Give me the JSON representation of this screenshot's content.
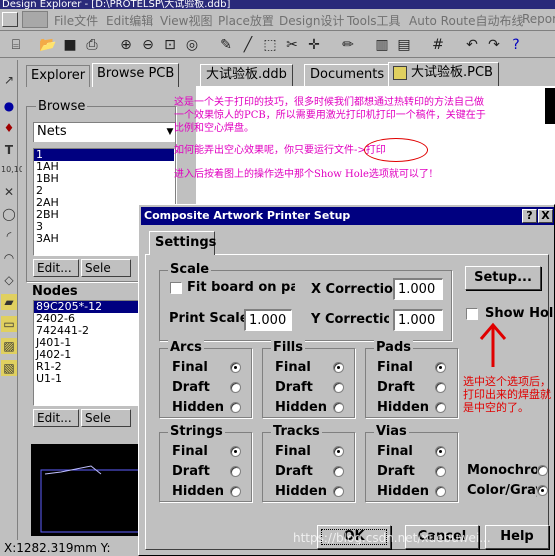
{
  "app": {
    "title": "Design Explorer - [D:\\PROTELSP\\大试验板.ddb]"
  },
  "menu": [
    "File文件",
    "Edit编辑",
    "View视图",
    "Place放置",
    "Design设计",
    "Tools工具",
    "Auto Route自动布线",
    "Report"
  ],
  "toolbar_icons": [
    "pcb-icon",
    "open-icon",
    "save-icon",
    "print-icon",
    "zoom-in-icon",
    "zoom-out-icon",
    "zoom-fit-icon",
    "zoom-area-icon",
    "wire-icon",
    "line-icon",
    "select-icon",
    "deselect-icon",
    "move-icon",
    "pen-icon",
    "library-icon",
    "browse-icon",
    "grid-icon",
    "undo-icon",
    "redo-icon",
    "help-icon"
  ],
  "left_tools": [
    "arrow-icon",
    "dot-icon",
    "pin-icon",
    "text-icon",
    "coordinate-icon",
    "cross-icon",
    "circle-icon",
    "arc-icon",
    "fill-icon",
    "polygon-icon",
    "dimension-icon",
    "rect-icon",
    "zone-icon",
    "edit-icon"
  ],
  "panel": {
    "tab_explorer": "Explorer",
    "tab_browse": "Browse PCB",
    "browse_label": "Browse",
    "browse_select": "Nets",
    "nets": [
      "1",
      "1AH",
      "1BH",
      "2",
      "2AH",
      "2BH",
      "3",
      "3AH"
    ],
    "edit_button": "Edit...",
    "select_button": "Sele",
    "nodes_label": "Nodes",
    "nodes": [
      "89C205*-12",
      "2402-6",
      "742441-2",
      "J401-1",
      "J402-1",
      "R1-2",
      "U1-1"
    ],
    "edit_button2": "Edit...",
    "select_button2": "Sele"
  },
  "status": {
    "coords": "X:1282.319mm Y:"
  },
  "doc_tabs": [
    "大试验板.ddb",
    "Documents",
    "大试验板.PCB"
  ],
  "notes": {
    "line1": "这是一个关于打印的技巧，很多时候我们都想通过热转印的方法自己做",
    "line2": "一个效果惊人的PCB，所以需要用激光打印机打印一个稿件，关键在于",
    "line3": "比例和空心焊盘。",
    "line4": "如何能弄出空心效果呢，你只要运行文件->打印",
    "line5": "进入后按着图上的操作选中那个Show Hole选项就可以了!"
  },
  "dialog": {
    "title": "Composite Artwork Printer Setup",
    "help_btn": "?",
    "close_btn": "X",
    "tab": "Settings",
    "scale_title": "Scale",
    "fit_board": "Fit board on page",
    "x_correction_label": "X Correction",
    "x_correction": "1.000",
    "print_scale_label": "Print Scale",
    "print_scale": "1.000",
    "y_correction_label": "Y Correction",
    "y_correction": "1.000",
    "setup_button": "Setup...",
    "show_hole": "Show Hole",
    "groups": [
      {
        "title": "Arcs",
        "selected": 0
      },
      {
        "title": "Fills",
        "selected": 0
      },
      {
        "title": "Pads",
        "selected": 0
      },
      {
        "title": "Strings",
        "selected": 0
      },
      {
        "title": "Tracks",
        "selected": 0
      },
      {
        "title": "Vias",
        "selected": 0
      }
    ],
    "modes": [
      "Final",
      "Draft",
      "Hidden"
    ],
    "monochrome": "Monochrome",
    "color_gray": "Color/Gray",
    "ok": "OK",
    "cancel": "Cancel",
    "help": "Help",
    "annotation": [
      "选中这个选项后，",
      "打印出来的焊盘就",
      "是中空的了。"
    ],
    "watermark": "https://blog.csdn.net/xuebuwei..."
  }
}
